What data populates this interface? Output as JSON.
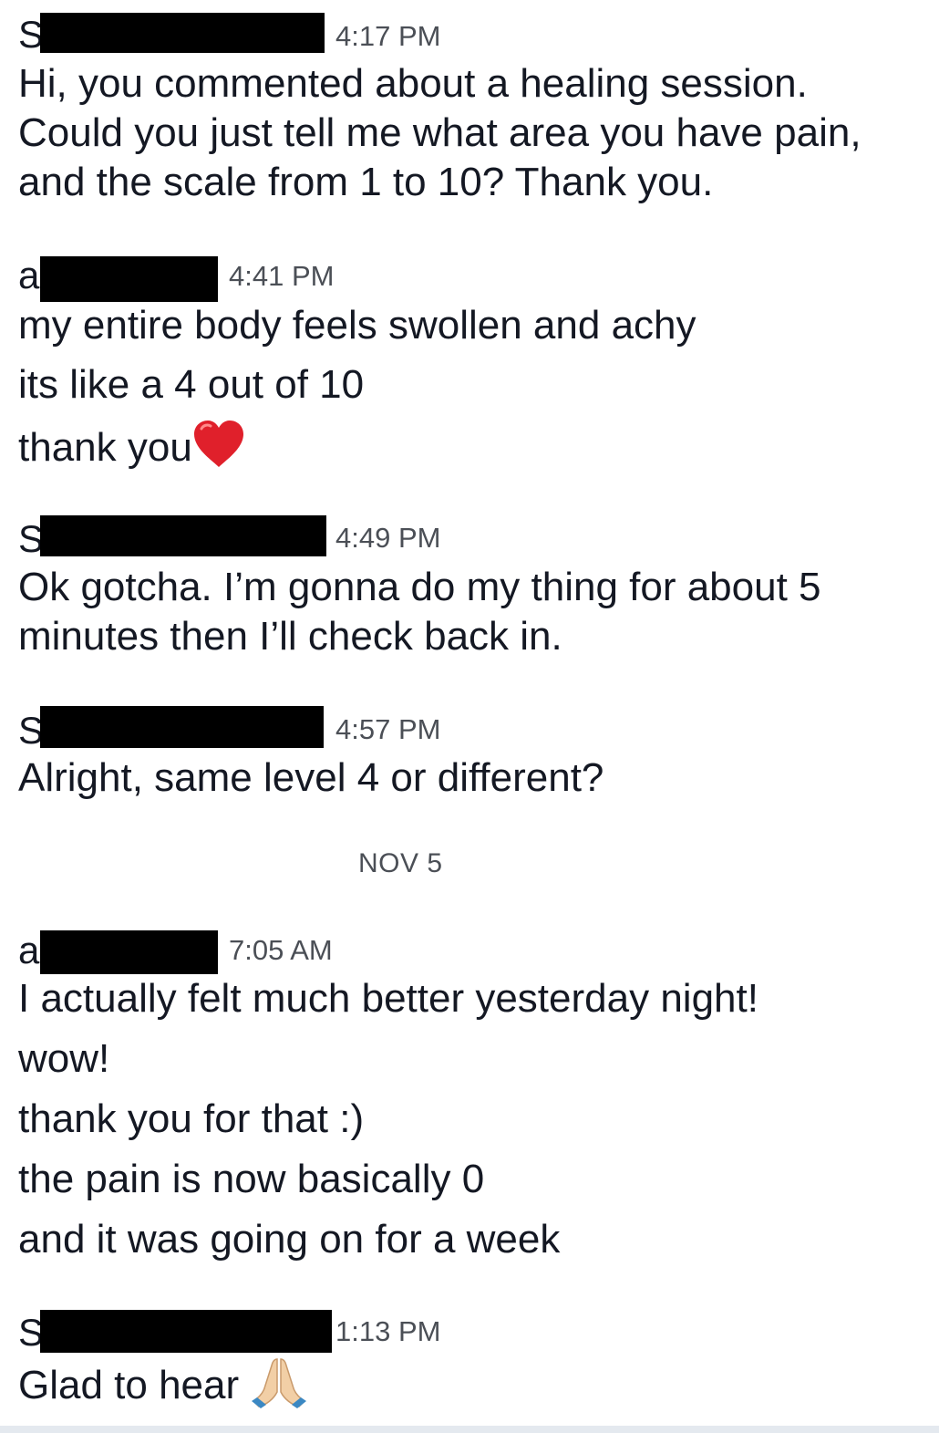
{
  "messages": [
    {
      "initial": "S",
      "time": "4:17 PM",
      "lines": [
        "Hi, you commented about a healing session.",
        "Could you just tell me what area you have pain,",
        "and the scale from 1 to 10? Thank you."
      ]
    },
    {
      "initial": "a",
      "time": "4:41 PM",
      "lines": [
        "my entire body feels swollen and achy",
        "its like a 4 out of 10",
        "thank you"
      ],
      "emoji": "heart-icon"
    },
    {
      "initial": "S",
      "time": "4:49 PM",
      "lines": [
        "Ok gotcha. I’m gonna do my thing for about 5",
        "minutes then I’ll check back in."
      ]
    },
    {
      "initial": "S",
      "time": "4:57 PM",
      "lines": [
        "Alright, same level 4 or different?"
      ]
    },
    {
      "initial": "a",
      "time": "7:05 AM",
      "lines": [
        "I actually felt much better yesterday night!",
        "wow!",
        "thank you for that :)",
        "the pain is now basically 0",
        "and it was going on for a week"
      ]
    },
    {
      "initial": "S",
      "time": "1:13 PM",
      "lines": [
        "Glad to hear"
      ],
      "emoji": "folded-hands-icon"
    }
  ],
  "date_divider": "NOV 5",
  "colors": {
    "text": "#141823",
    "meta": "#4b4f56",
    "redaction": "#000000",
    "heart": "#e0202b",
    "bottom_bar": "#e4e9ef"
  }
}
